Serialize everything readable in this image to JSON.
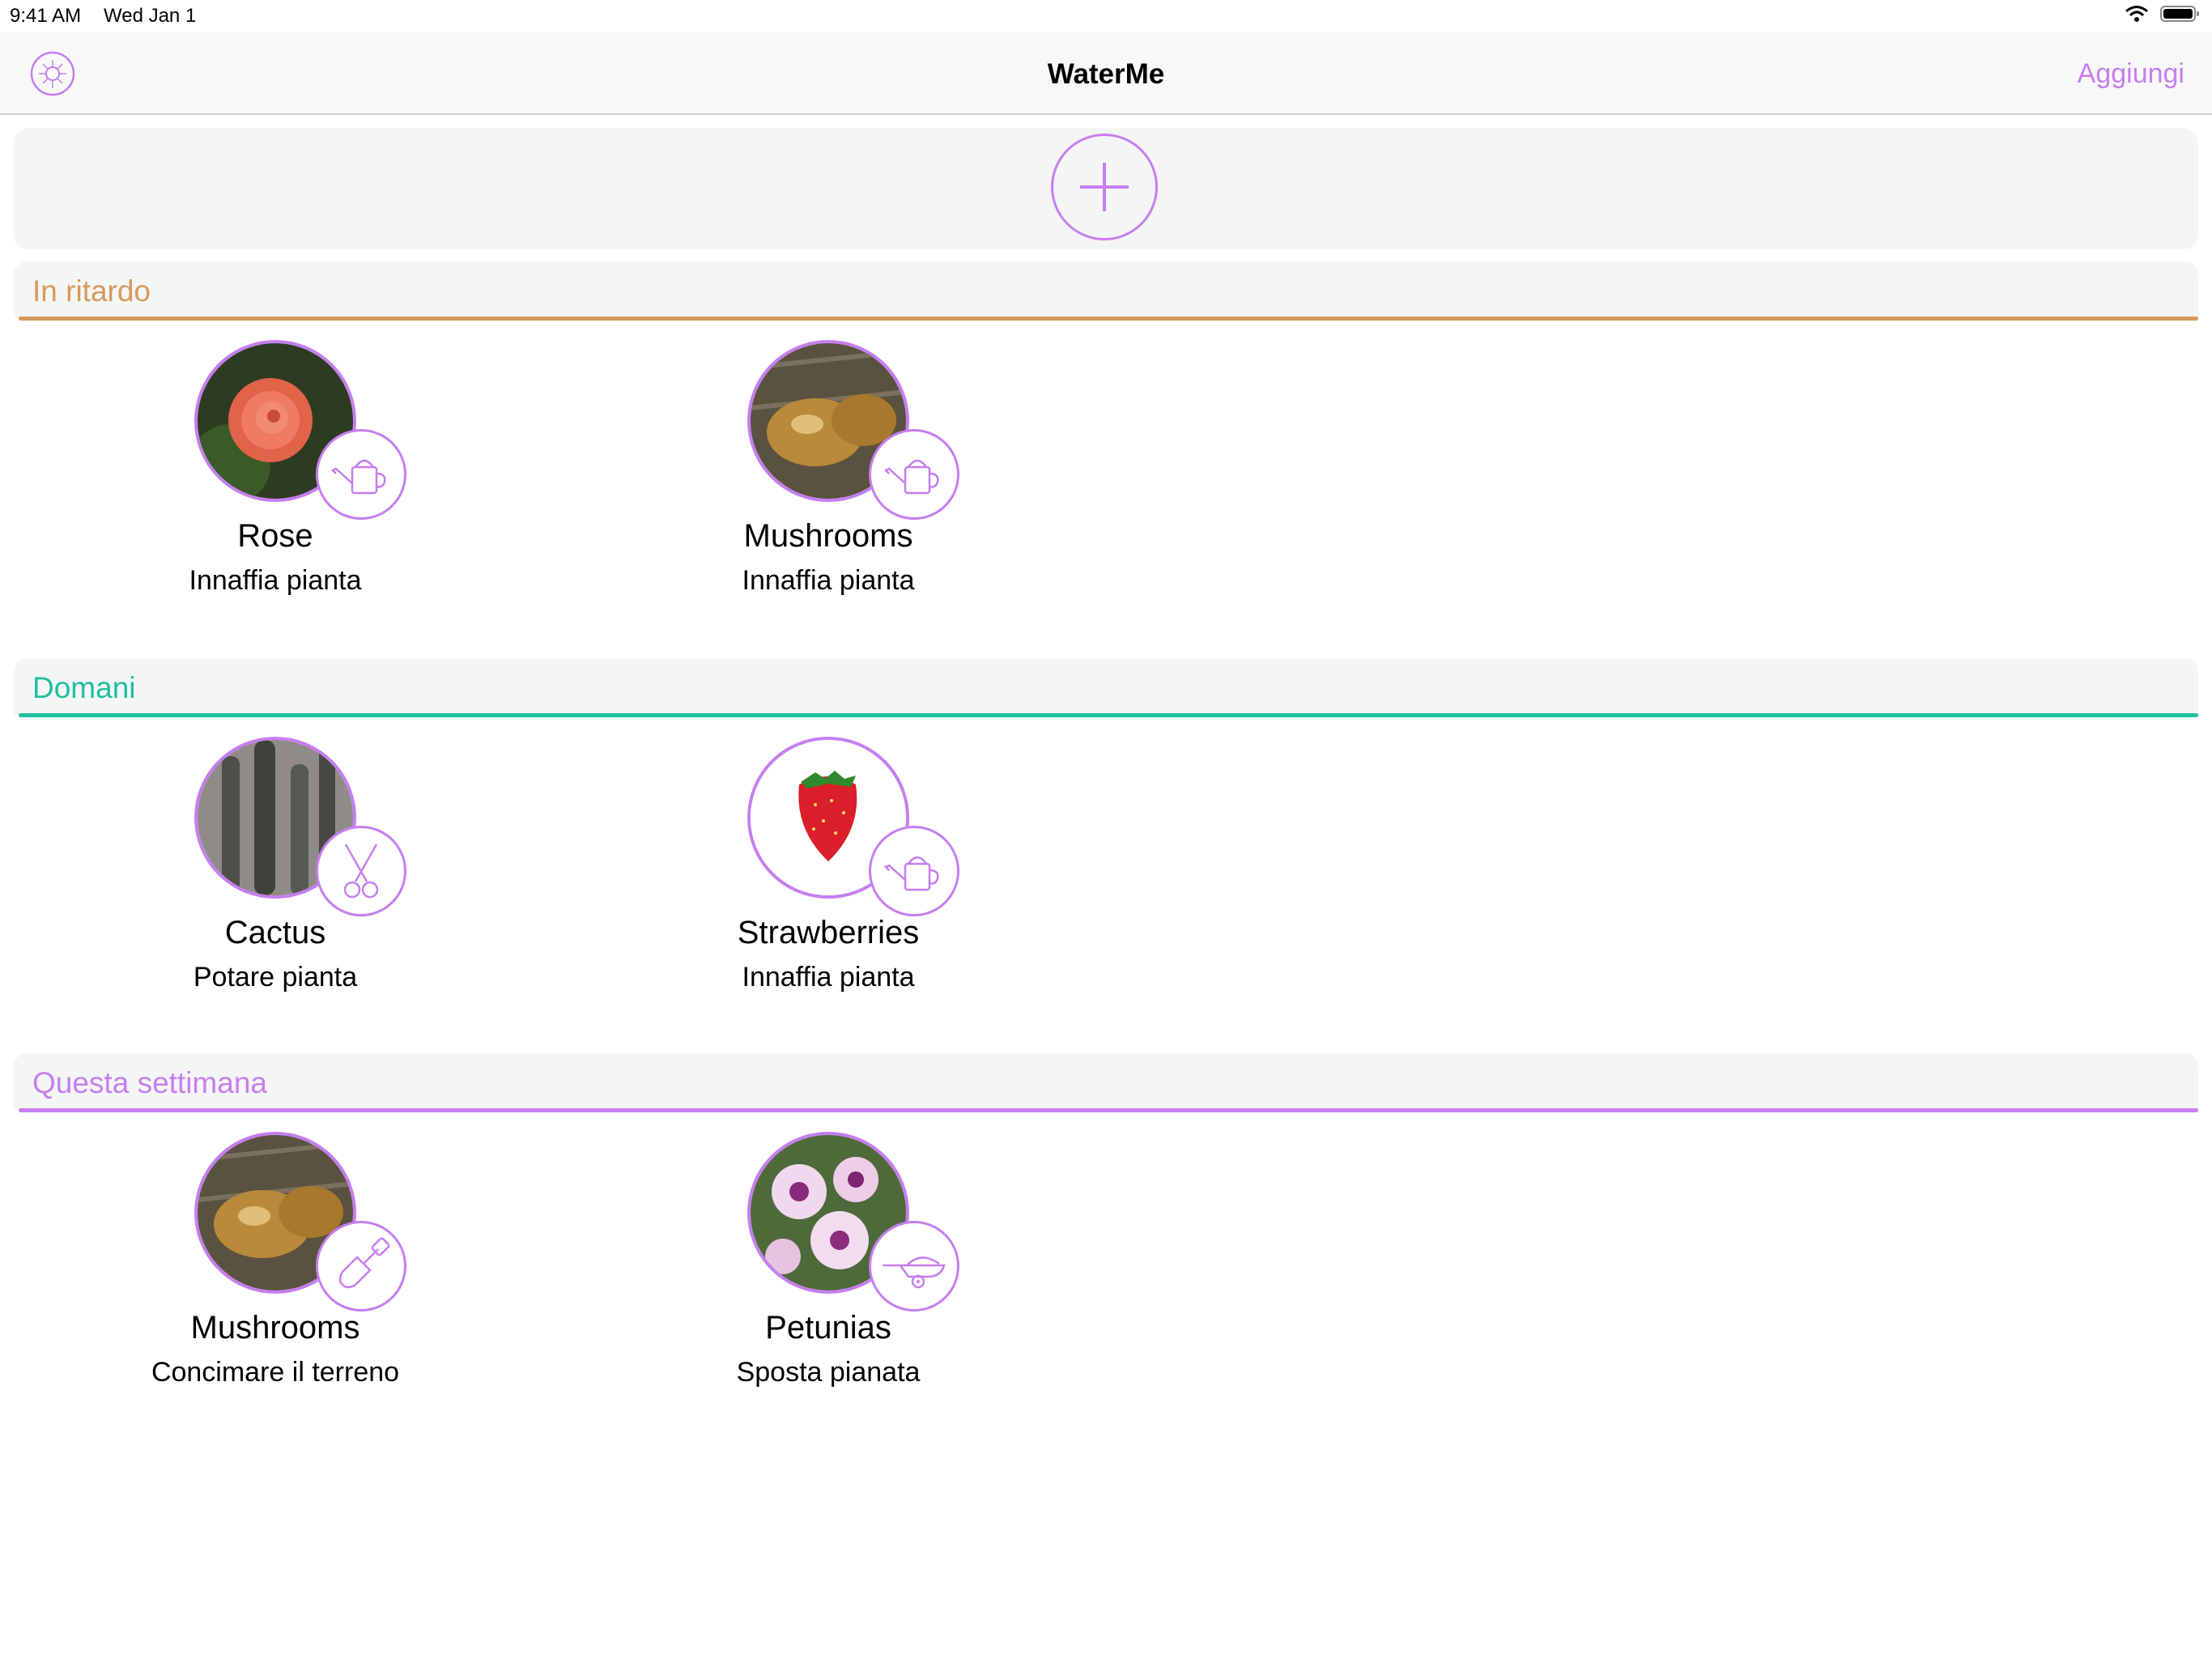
{
  "status_bar": {
    "time": "9:41 AM",
    "date": "Wed Jan 1"
  },
  "nav": {
    "title": "WaterMe",
    "add_label": "Aggiungi",
    "left_icon": "settings-flower-icon"
  },
  "colors": {
    "accent": "#c67ef0",
    "late": "#d8995b",
    "tomorrow": "#1fbf9f",
    "this_week": "#c67ef0"
  },
  "sections": [
    {
      "title": "In ritardo",
      "items": [
        {
          "name": "Rose",
          "task": "Innaffia pianta",
          "task_icon": "watering-can-icon",
          "photo": "rose-photo"
        },
        {
          "name": "Mushrooms",
          "task": "Innaffia pianta",
          "task_icon": "watering-can-icon",
          "photo": "mushroom-photo"
        }
      ]
    },
    {
      "title": "Domani",
      "items": [
        {
          "name": "Cactus",
          "task": "Potare pianta",
          "task_icon": "scissors-icon",
          "photo": "cactus-photo"
        },
        {
          "name": "Strawberries",
          "task": "Innaffia pianta",
          "task_icon": "watering-can-icon",
          "photo": "strawberry-photo"
        }
      ]
    },
    {
      "title": "Questa settimana",
      "items": [
        {
          "name": "Mushrooms",
          "task": "Concimare il terreno",
          "task_icon": "shovel-icon",
          "photo": "mushroom-photo"
        },
        {
          "name": "Petunias",
          "task": "Sposta pianata",
          "task_icon": "wheelbarrow-icon",
          "photo": "petunia-photo"
        }
      ]
    }
  ]
}
